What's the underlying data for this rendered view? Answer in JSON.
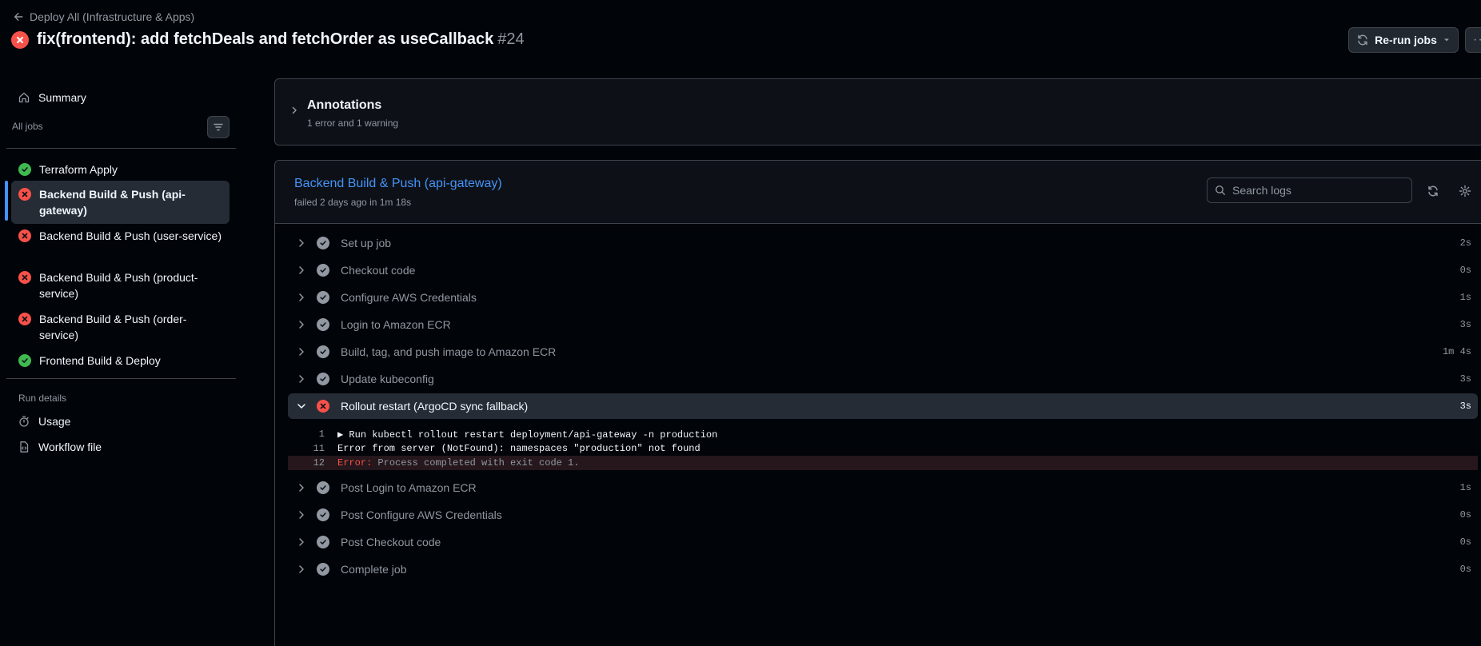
{
  "header": {
    "back_label": "Deploy All (Infrastructure & Apps)",
    "title": "fix(frontend): add fetchDeals and fetchOrder as useCallback",
    "run_number": "#24",
    "rerun_label": "Re-run jobs",
    "more_label": "···"
  },
  "sidebar": {
    "summary_label": "Summary",
    "all_jobs_label": "All jobs",
    "jobs": [
      {
        "label": "Terraform Apply",
        "status": "success"
      },
      {
        "label": "Backend Build & Push (api-gateway)",
        "status": "failure",
        "active": true
      },
      {
        "label": "Backend Build & Push (user-service)",
        "status": "failure"
      },
      {
        "label": "Backend Build & Push (product-service)",
        "status": "failure"
      },
      {
        "label": "Backend Build & Push (order-service)",
        "status": "failure"
      },
      {
        "label": "Frontend Build & Deploy",
        "status": "success"
      }
    ],
    "run_details_label": "Run details",
    "usage_label": "Usage",
    "workflow_file_label": "Workflow file"
  },
  "annotations": {
    "title": "Annotations",
    "summary": "1 error and 1 warning"
  },
  "job": {
    "title": "Backend Build & Push (api-gateway)",
    "meta": "failed 2 days ago in 1m 18s",
    "search_placeholder": "Search logs"
  },
  "steps": [
    {
      "name": "Set up job",
      "duration": "2s",
      "status": "success"
    },
    {
      "name": "Checkout code",
      "duration": "0s",
      "status": "success"
    },
    {
      "name": "Configure AWS Credentials",
      "duration": "1s",
      "status": "success"
    },
    {
      "name": "Login to Amazon ECR",
      "duration": "3s",
      "status": "success"
    },
    {
      "name": "Build, tag, and push image to Amazon ECR",
      "duration": "1m 4s",
      "status": "success"
    },
    {
      "name": "Update kubeconfig",
      "duration": "3s",
      "status": "success"
    },
    {
      "name": "Rollout restart (ArgoCD sync fallback)",
      "duration": "3s",
      "status": "failure",
      "expanded": true
    },
    {
      "name": "Post Login to Amazon ECR",
      "duration": "1s",
      "status": "success"
    },
    {
      "name": "Post Configure AWS Credentials",
      "duration": "0s",
      "status": "success"
    },
    {
      "name": "Post Checkout code",
      "duration": "0s",
      "status": "success"
    },
    {
      "name": "Complete job",
      "duration": "0s",
      "status": "success"
    }
  ],
  "log_lines": [
    {
      "num": "1",
      "text": "▶ Run kubectl rollout restart deployment/api-gateway -n production"
    },
    {
      "num": "11",
      "text": "Error from server (NotFound): namespaces \"production\" not found"
    },
    {
      "num": "12",
      "error_label": "Error:",
      "error_msg": " Process completed with exit code 1."
    }
  ],
  "colors": {
    "success": "#3fb950",
    "failure": "#f85149",
    "accent": "#4493f8",
    "step_done": "#9198a1"
  }
}
